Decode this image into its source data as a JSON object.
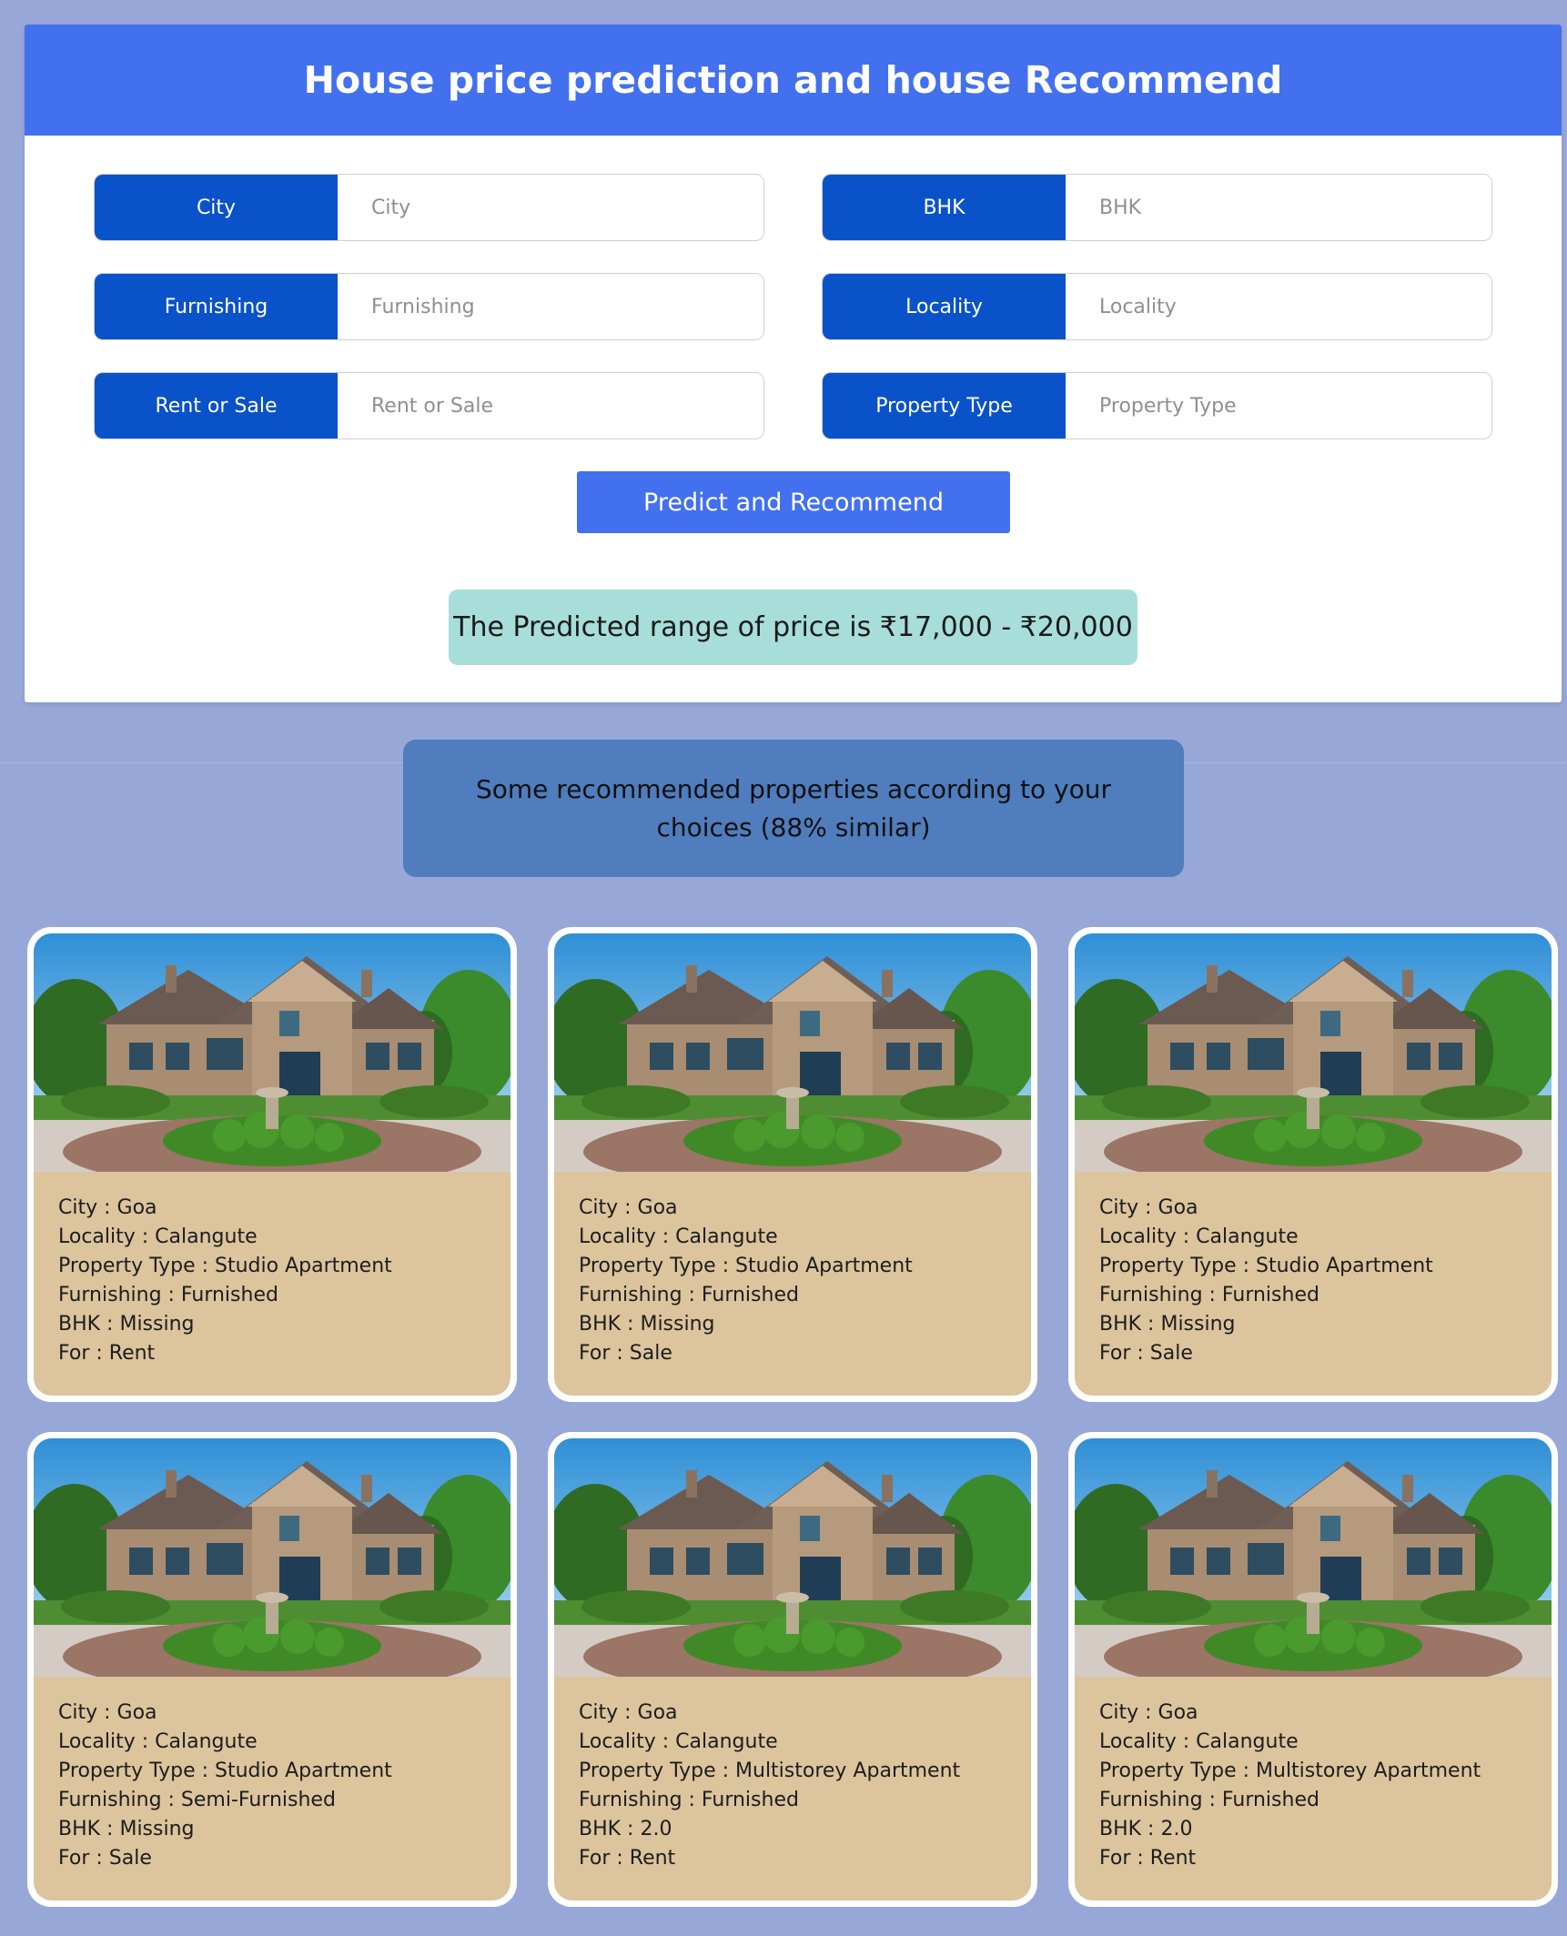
{
  "header": {
    "title": "House price prediction and house Recommend"
  },
  "form": {
    "fields": [
      {
        "label": "City",
        "placeholder": "City"
      },
      {
        "label": "BHK",
        "placeholder": "BHK"
      },
      {
        "label": "Furnishing",
        "placeholder": "Furnishing"
      },
      {
        "label": "Locality",
        "placeholder": "Locality"
      },
      {
        "label": "Rent or Sale",
        "placeholder": "Rent or Sale"
      },
      {
        "label": "Property Type",
        "placeholder": "Property Type"
      }
    ],
    "submit_label": "Predict and Recommend"
  },
  "result": {
    "text": "The Predicted range of price is ₹17,000 - ₹20,000"
  },
  "recommendations": {
    "banner": "Some recommended properties according to your choices (88% similar)",
    "properties": [
      {
        "city": "City : Goa",
        "locality": "Locality : Calangute",
        "property_type": "Property Type : Studio Apartment",
        "furnishing": "Furnishing : Furnished",
        "bhk": "BHK : Missing",
        "for": "For : Rent"
      },
      {
        "city": "City : Goa",
        "locality": "Locality : Calangute",
        "property_type": "Property Type : Studio Apartment",
        "furnishing": "Furnishing : Furnished",
        "bhk": "BHK : Missing",
        "for": "For : Sale"
      },
      {
        "city": "City : Goa",
        "locality": "Locality : Calangute",
        "property_type": "Property Type : Studio Apartment",
        "furnishing": "Furnishing : Furnished",
        "bhk": "BHK : Missing",
        "for": "For : Sale"
      },
      {
        "city": "City : Goa",
        "locality": "Locality : Calangute",
        "property_type": "Property Type : Studio Apartment",
        "furnishing": "Furnishing : Semi-Furnished",
        "bhk": "BHK : Missing",
        "for": "For : Sale"
      },
      {
        "city": "City : Goa",
        "locality": "Locality : Calangute",
        "property_type": "Property Type : Multistorey Apartment",
        "furnishing": "Furnishing : Furnished",
        "bhk": "BHK : 2.0",
        "for": "For : Rent"
      },
      {
        "city": "City : Goa",
        "locality": "Locality : Calangute",
        "property_type": "Property Type : Multistorey Apartment",
        "furnishing": "Furnishing : Furnished",
        "bhk": "BHK : 2.0",
        "for": "For : Rent"
      }
    ]
  },
  "colors": {
    "background": "#97a8d8",
    "header": "#4270ee",
    "label": "#0a52c9",
    "result": "#a7ded9",
    "banner": "#4f7dbd",
    "card": "#dcc49d"
  }
}
